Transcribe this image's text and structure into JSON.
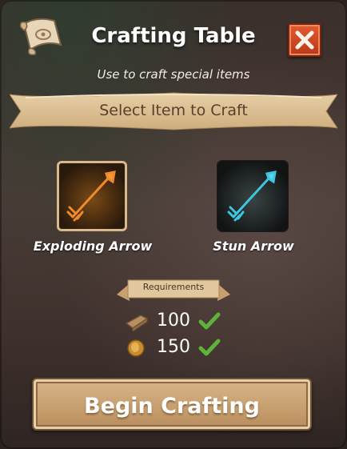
{
  "header": {
    "title": "Crafting Table",
    "subtitle": "Use to craft special items",
    "close_icon": "close-icon",
    "scroll_icon": "scroll-icon"
  },
  "selector": {
    "label": "Select Item to Craft"
  },
  "items": [
    {
      "label": "Exploding Arrow",
      "icon": "exploding-arrow-icon",
      "selected": true,
      "color": "#e07a22"
    },
    {
      "label": "Stun Arrow",
      "icon": "stun-arrow-icon",
      "selected": false,
      "color": "#3ec6e0"
    }
  ],
  "requirements": {
    "title": "Requirements",
    "rows": [
      {
        "icon": "wood-plank-icon",
        "amount": "100",
        "met": true
      },
      {
        "icon": "gold-coin-icon",
        "amount": "150",
        "met": true
      }
    ]
  },
  "actions": {
    "begin_label": "Begin Crafting"
  },
  "colors": {
    "accent_close": "#c8452a",
    "button_tan": "#c8a070",
    "check_green": "#5fb33a"
  }
}
